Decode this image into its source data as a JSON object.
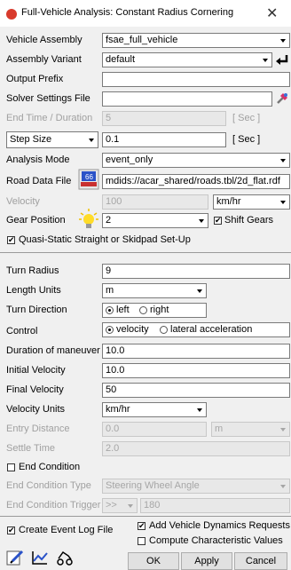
{
  "window": {
    "title": "Full-Vehicle Analysis: Constant Radius Cornering",
    "close": "✕"
  },
  "form": {
    "vehicle_assembly": {
      "label": "Vehicle Assembly",
      "value": "fsae_full_vehicle"
    },
    "assembly_variant": {
      "label": "Assembly Variant",
      "value": "default"
    },
    "output_prefix": {
      "label": "Output Prefix",
      "value": ""
    },
    "solver_settings": {
      "label": "Solver Settings File",
      "value": ""
    },
    "end_time": {
      "label": "End Time / Duration",
      "value": "5",
      "unit": "[ Sec ]"
    },
    "step_size": {
      "label": "Step Size",
      "value": "0.1",
      "unit": "[ Sec ]"
    },
    "analysis_mode": {
      "label": "Analysis Mode",
      "value": "event_only"
    },
    "road_data_file": {
      "label": "Road Data File",
      "value": "mdids://acar_shared/roads.tbl/2d_flat.rdf"
    },
    "velocity": {
      "label": "Velocity",
      "value": "100",
      "unit": "km/hr"
    },
    "gear_position": {
      "label": "Gear Position",
      "value": "2",
      "shift_gears": "Shift Gears"
    },
    "quasi_static": "Quasi-Static Straight or Skidpad Set-Up",
    "turn_radius": {
      "label": "Turn Radius",
      "value": "9"
    },
    "length_units": {
      "label": "Length Units",
      "value": "m"
    },
    "turn_direction": {
      "label": "Turn Direction",
      "left": "left",
      "right": "right"
    },
    "control": {
      "label": "Control",
      "velocity": "velocity",
      "lateral": "lateral acceleration"
    },
    "duration": {
      "label": "Duration of maneuver",
      "value": "10.0"
    },
    "initial_velocity": {
      "label": "Initial Velocity",
      "value": "10.0"
    },
    "final_velocity": {
      "label": "Final Velocity",
      "value": "50"
    },
    "velocity_units": {
      "label": "Velocity Units",
      "value": "km/hr"
    },
    "entry_distance": {
      "label": "Entry Distance",
      "value": "0.0",
      "unit": "m"
    },
    "settle_time": {
      "label": "Settle Time",
      "value": "2.0"
    },
    "end_condition": "End Condition",
    "end_condition_type": {
      "label": "End Condition Type",
      "value": "Steering Wheel Angle"
    },
    "end_condition_trigger": {
      "label": "End Condition Trigger",
      "op": ">>",
      "value": "180"
    }
  },
  "footer": {
    "create_event_log": "Create Event Log File",
    "add_vdr": "Add Vehicle Dynamics Requests",
    "compute_char": "Compute Characteristic Values",
    "ok": "OK",
    "apply": "Apply",
    "cancel": "Cancel"
  },
  "colors": {
    "accent": "#d83a2c",
    "disabled_text": "#a0a0a0"
  }
}
